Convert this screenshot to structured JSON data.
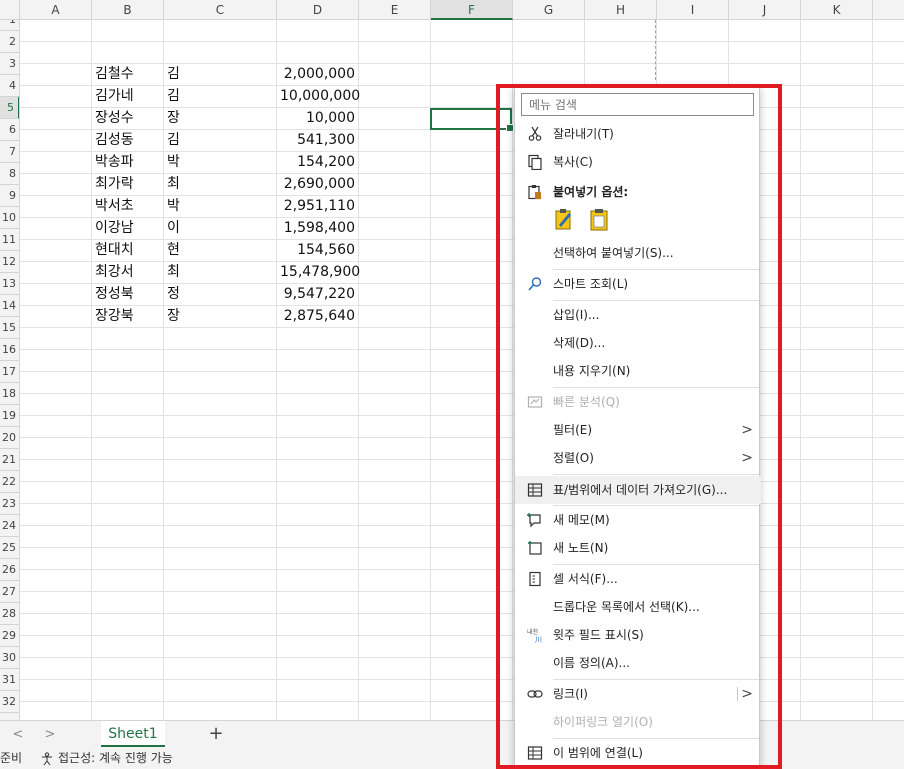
{
  "columns": [
    "A",
    "B",
    "C",
    "D",
    "E",
    "F",
    "G",
    "H",
    "I",
    "J",
    "K"
  ],
  "selected_column": "F",
  "rows": [
    "1",
    "2",
    "3",
    "4",
    "5",
    "6",
    "7",
    "8",
    "9",
    "10",
    "11",
    "12",
    "13",
    "14",
    "15",
    "16",
    "17",
    "18",
    "19",
    "20",
    "21",
    "22",
    "23",
    "24",
    "25",
    "26",
    "27",
    "28",
    "29",
    "30",
    "31",
    "32"
  ],
  "selected_row": "5",
  "table": [
    {
      "b": "김철수",
      "c": "김",
      "d": "2,000,000"
    },
    {
      "b": "김가네",
      "c": "김",
      "d": "10,000,000"
    },
    {
      "b": "장성수",
      "c": "장",
      "d": "10,000"
    },
    {
      "b": "김성동",
      "c": "김",
      "d": "541,300"
    },
    {
      "b": "박송파",
      "c": "박",
      "d": "154,200"
    },
    {
      "b": "최가락",
      "c": "최",
      "d": "2,690,000"
    },
    {
      "b": "박서초",
      "c": "박",
      "d": "2,951,110"
    },
    {
      "b": "이강남",
      "c": "이",
      "d": "1,598,400"
    },
    {
      "b": "현대치",
      "c": "현",
      "d": "154,560"
    },
    {
      "b": "최강서",
      "c": "최",
      "d": "15,478,900"
    },
    {
      "b": "정성북",
      "c": "정",
      "d": "9,547,220"
    },
    {
      "b": "장강북",
      "c": "장",
      "d": "2,875,640"
    }
  ],
  "sheet_tab": "Sheet1",
  "add_sheet": "+",
  "nav_prev": "<",
  "nav_next": ">",
  "status": {
    "ready": "준비",
    "accessibility": "접근성: 계속 진행 가능"
  },
  "menu": {
    "search_placeholder": "메뉴 검색",
    "cut": "잘라내기(T)",
    "copy": "복사(C)",
    "paste_options": "붙여넣기 옵션:",
    "paste_special": "선택하여 붙여넣기(S)...",
    "smart_lookup": "스마트 조회(L)",
    "insert": "삽입(I)...",
    "delete": "삭제(D)...",
    "clear_contents": "내용 지우기(N)",
    "quick_analysis": "빠른 분석(Q)",
    "filter": "필터(E)",
    "sort": "정렬(O)",
    "get_data": "표/범위에서 데이터 가져오기(G)...",
    "new_comment": "새 메모(M)",
    "new_note": "새 노트(N)",
    "format_cells": "셀 서식(F)...",
    "pick_dropdown": "드롭다운 목록에서 선택(K)...",
    "phonetic": "윗주 필드 표시(S)",
    "define_name": "이름 정의(A)...",
    "link": "링크(I)",
    "open_hyperlink": "하이퍼링크 열기(O)",
    "link_to_range": "이 범위에 연결(L)",
    "submenu_arrow": ">"
  },
  "colors": {
    "accent": "#217346",
    "highlight_box": "#e01b24"
  }
}
